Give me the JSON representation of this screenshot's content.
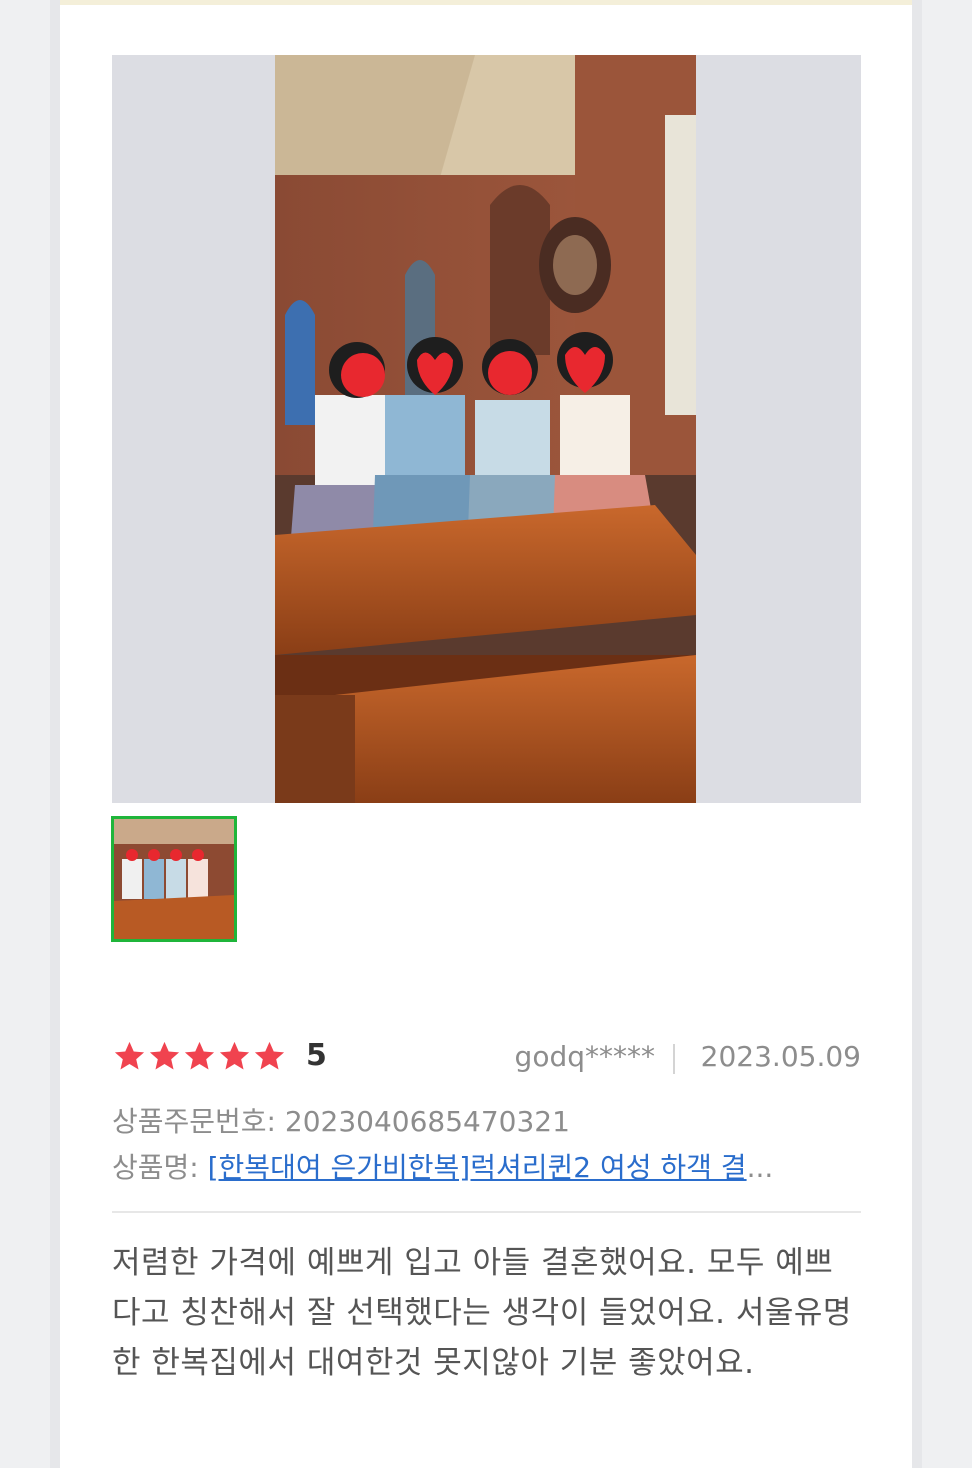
{
  "review": {
    "rating_value": "5",
    "reviewer": "godq*****",
    "date": "2023.05.09",
    "order_label": "상품주문번호:",
    "order_number": "2023040685470321",
    "product_label": "상품명:",
    "product_name": "[한복대여 은가비한복]럭셔리퀸2 여성 하객 결",
    "product_ellipsis": "...",
    "text": "저렴한 가격에 예쁘게 입고 아들 결혼했어요. 모두 예쁘다고 칭찬해서 잘 선택했다는 생각이 들었어요. 서울유명한 한복집에서 대여한것 못지않아 기분 좋았어요."
  },
  "colors": {
    "star": "#f0434f",
    "thumb_border": "#1fb53a",
    "link": "#2a6dcc",
    "viewer_bg": "#dcdde3"
  },
  "icons": [
    "star-icon"
  ]
}
